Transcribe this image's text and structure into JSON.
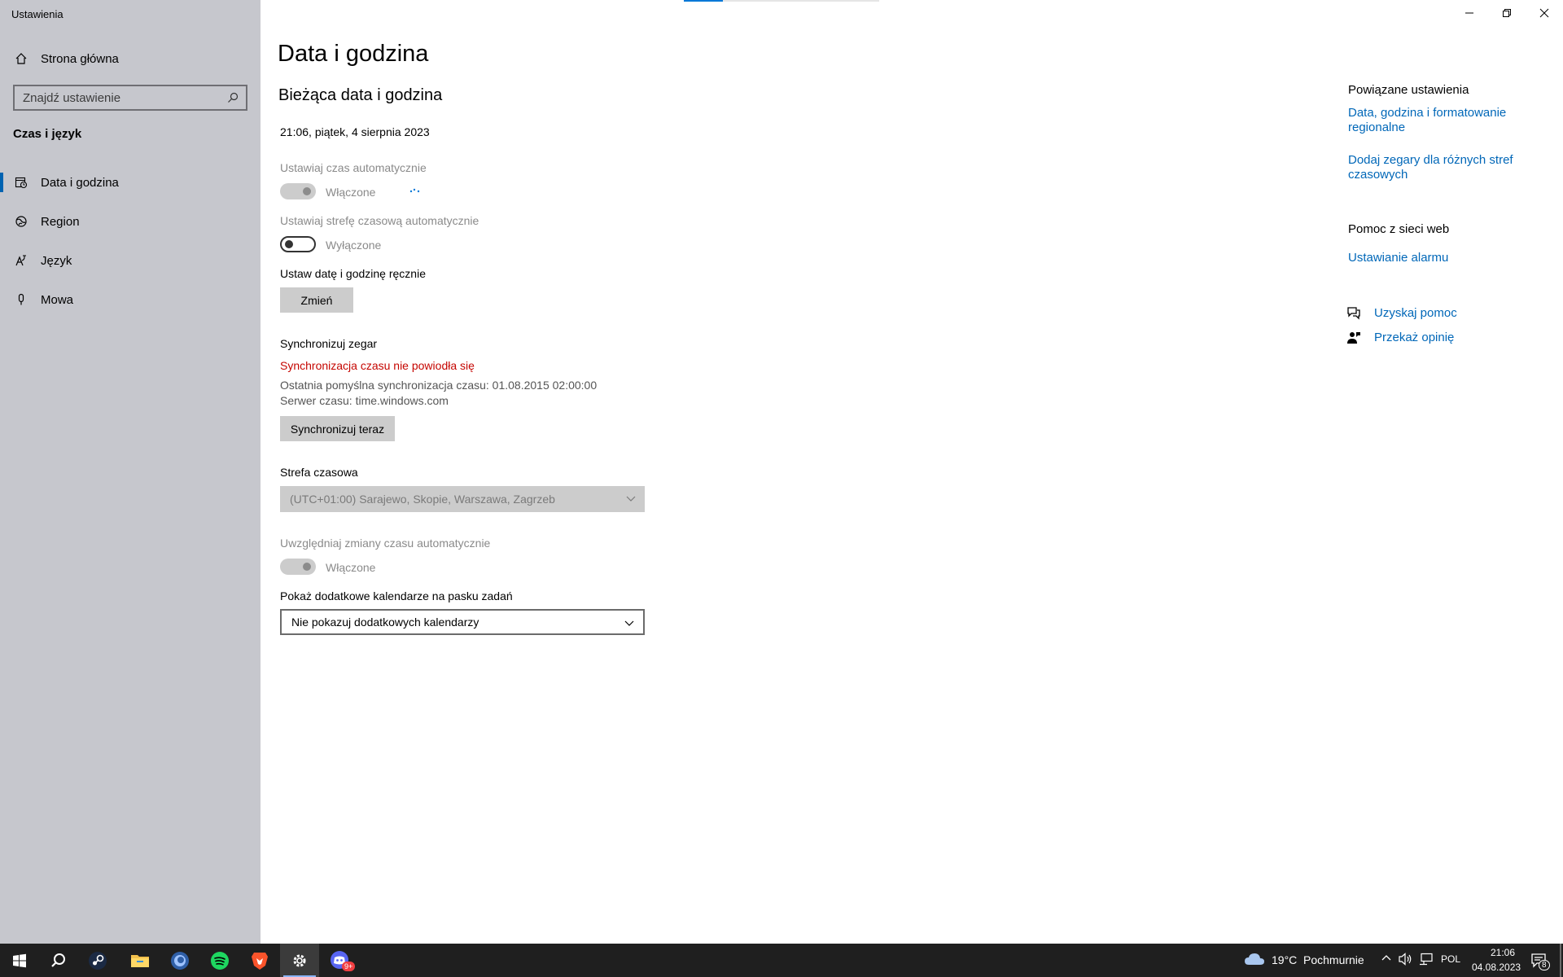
{
  "window": {
    "app_title": "Ustawienia",
    "minimize_glyph": "—",
    "maximize_glyph": "❐",
    "close_glyph": "✕"
  },
  "sidebar": {
    "home_label": "Strona główna",
    "search_placeholder": "Znajdź ustawienie",
    "section_heading": "Czas i język",
    "items": [
      {
        "label": "Data i godzina",
        "icon": "calendar-clock-icon",
        "active": true
      },
      {
        "label": "Region",
        "icon": "globe-icon",
        "active": false
      },
      {
        "label": "Język",
        "icon": "language-icon",
        "active": false
      },
      {
        "label": "Mowa",
        "icon": "microphone-icon",
        "active": false
      }
    ]
  },
  "main": {
    "page_title": "Data i godzina",
    "section_title": "Bieżąca data i godzina",
    "current_datetime": "21:06, piątek, 4 sierpnia 2023",
    "auto_time_label": "Ustawiaj czas automatycznie",
    "auto_time_state": "Włączone",
    "auto_tz_label": "Ustawiaj strefę czasową automatycznie",
    "auto_tz_state": "Wyłączone",
    "manual_label": "Ustaw datę i godzinę ręcznie",
    "change_button": "Zmień",
    "sync_heading": "Synchronizuj zegar",
    "sync_error": "Synchronizacja czasu nie powiodła się",
    "last_sync": "Ostatnia pomyślna synchronizacja czasu: 01.08.2015 02:00:00",
    "time_server": "Serwer czasu: time.windows.com",
    "sync_button": "Synchronizuj teraz",
    "timezone_label": "Strefa czasowa",
    "timezone_value": "(UTC+01:00) Sarajewo, Skopie, Warszawa, Zagrzeb",
    "dst_label": "Uwzględniaj zmiany czasu automatycznie",
    "dst_state": "Włączone",
    "calendars_label": "Pokaż dodatkowe kalendarze na pasku zadań",
    "calendars_value": "Nie pokazuj dodatkowych kalendarzy"
  },
  "related": {
    "heading": "Powiązane ustawienia",
    "link1_line1": "Data, godzina i formatowanie",
    "link1_line2": "regionalne",
    "link2_line1": "Dodaj zegary dla różnych stref",
    "link2_line2": "czasowych",
    "web_heading": "Pomoc z sieci web",
    "alarm_link": "Ustawianie alarmu",
    "get_help": "Uzyskaj pomoc",
    "feedback": "Przekaż opinię"
  },
  "taskbar": {
    "weather_temp": "19°C",
    "weather_desc": "Pochmurnie",
    "language": "POL",
    "time": "21:06",
    "date": "04.08.2023",
    "notification_count": "8",
    "discord_badge": "9+",
    "apps": [
      "start-icon",
      "search-icon",
      "steam-icon",
      "file-explorer-icon",
      "browser-icon",
      "spotify-icon",
      "brave-icon",
      "settings-icon",
      "discord-icon"
    ]
  },
  "colors": {
    "sidebar_bg": "#c6c7cd",
    "accent": "#0063b1",
    "link": "#0067b8",
    "error": "#c50500",
    "taskbar": "#1f1f1f"
  }
}
